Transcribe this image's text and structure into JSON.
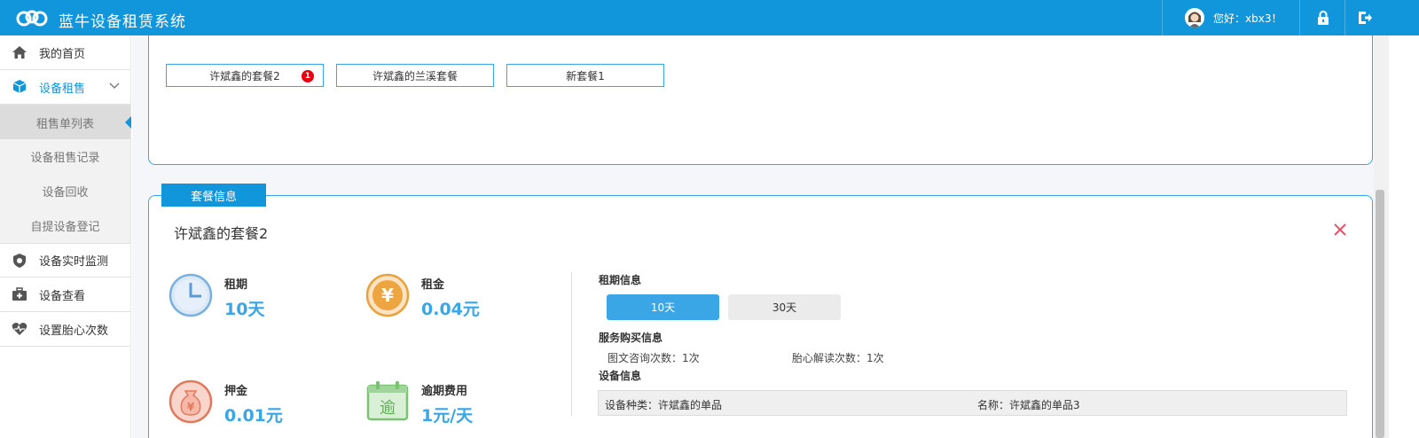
{
  "header": {
    "app_title": "蓝牛设备租赁系统",
    "greeting": "您好：xbx3！",
    "icons": [
      "logo-icon",
      "avatar-icon",
      "lock-icon",
      "logout-icon"
    ]
  },
  "sidebar": {
    "items": [
      {
        "label": "我的首页",
        "icon": "home-icon"
      },
      {
        "label": "设备租售",
        "icon": "cube-icon"
      },
      {
        "label": "设备实时监测",
        "icon": "shield-icon"
      },
      {
        "label": "设备查看",
        "icon": "medical-kit-icon"
      },
      {
        "label": "设置胎心次数",
        "icon": "heartbeat-icon"
      }
    ],
    "sub_items": [
      {
        "label": "租售单列表"
      },
      {
        "label": "设备租售记录"
      },
      {
        "label": "设备回收"
      },
      {
        "label": "自提设备登记"
      }
    ]
  },
  "packages": {
    "tabs": [
      {
        "label": "许斌鑫的套餐2",
        "badge": "1"
      },
      {
        "label": "许斌鑫的兰溪套餐"
      },
      {
        "label": "新套餐1"
      }
    ]
  },
  "detail": {
    "section_tag": "套餐信息",
    "title": "许斌鑫的套餐2",
    "stats": {
      "period": {
        "label": "租期",
        "value": "10天"
      },
      "rent": {
        "label": "租金",
        "value": "0.04元"
      },
      "deposit": {
        "label": "押金",
        "value": "0.01元"
      },
      "overdue": {
        "label": "逾期费用",
        "value": "1元/天"
      }
    },
    "period_info": {
      "heading": "租期信息",
      "options": [
        "10天",
        "30天"
      ]
    },
    "service_info": {
      "heading": "服务购买信息",
      "consult": "图文咨询次数：1次",
      "fetal": "胎心解读次数：1次"
    },
    "device_info": {
      "heading": "设备信息",
      "type": "设备种类：许斌鑫的单品",
      "name": "名称：许斌鑫的单品3"
    }
  },
  "colors": {
    "primary": "#1296db",
    "accent": "#3aa6e6",
    "badge": "#e60012",
    "close": "#e8506a"
  }
}
